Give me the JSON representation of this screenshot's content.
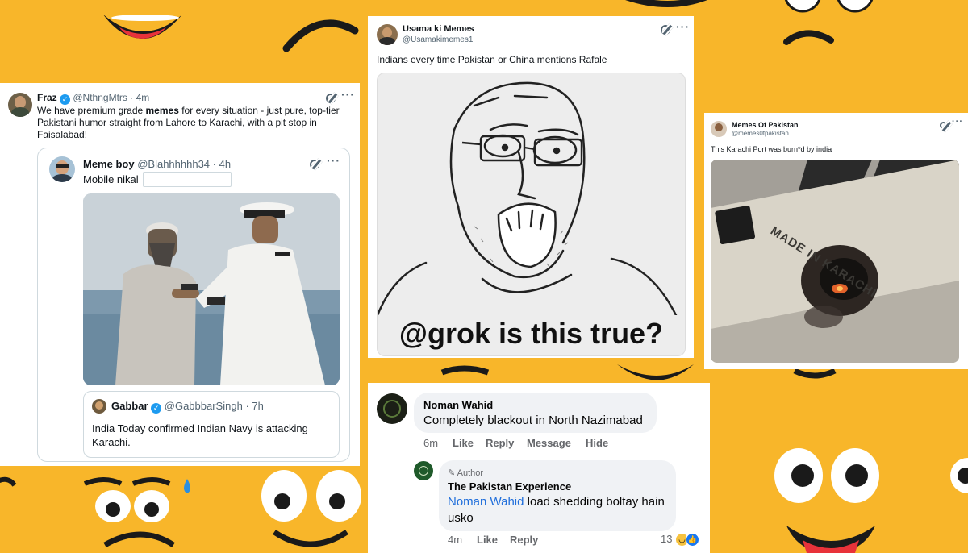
{
  "colors": {
    "background": "#f8b62a",
    "link": "#1d9bf0",
    "fb_link": "#216fdb"
  },
  "card1": {
    "name": "Fraz",
    "handle": "@NthngMtrs",
    "time": "4m",
    "text_before": "We have premium grade ",
    "text_bold": "memes",
    "text_after": " for every situation - just pure, top-tier Pakistani humor straight from Lahore to Karachi, with a pit stop in Faisalabad!",
    "quote": {
      "name": "Meme boy",
      "handle": "@Blahhhhhh34",
      "time": "4h",
      "text": "Mobile nikal"
    },
    "nested": {
      "name": "Gabbar",
      "handle": "@GabbbarSingh",
      "time": "7h",
      "text": "India Today confirmed Indian Navy is attacking Karachi."
    }
  },
  "card2": {
    "name": "Usama ki Memes",
    "handle": "@Usamakimemes1",
    "text": "Indians every time Pakistan or China mentions Rafale",
    "meme_caption": "@grok is this true?"
  },
  "card3": {
    "name": "Memes Of Pakistan",
    "handle": "@memes0fpakistan",
    "text": "This Karachi Port was burn*d by india",
    "laptop_text": "MADE IN KARACHI"
  },
  "fb": {
    "comment": {
      "name": "Noman Wahid",
      "text": "Completely blackout in North Nazimabad",
      "time": "6m",
      "actions": [
        "Like",
        "Reply",
        "Message",
        "Hide"
      ]
    },
    "reply": {
      "badge": "Author",
      "name": "The Pakistan Experience",
      "mention": "Noman Wahid",
      "text": " load shedding boltay hain usko",
      "time": "4m",
      "actions": [
        "Like",
        "Reply"
      ],
      "reactions": "13"
    }
  },
  "icons": [
    "verified-icon",
    "grok-icon",
    "more-icon",
    "pencil-icon",
    "like-reaction-icon",
    "laugh-reaction-icon"
  ]
}
